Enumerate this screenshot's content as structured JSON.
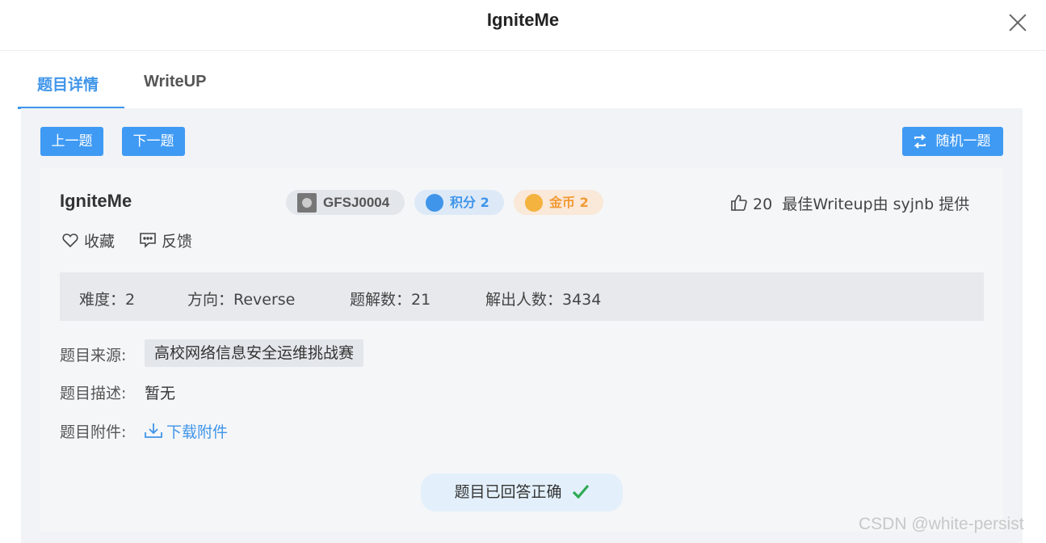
{
  "window": {
    "title": "IgniteMe"
  },
  "tabs": [
    {
      "label": "题目详情",
      "active": true
    },
    {
      "label": "WriteUP",
      "active": false
    }
  ],
  "nav": {
    "prev_label": "上一题",
    "next_label": "下一题",
    "random_label": "随机一题"
  },
  "challenge": {
    "name": "IgniteMe",
    "id": "GFSJ0004",
    "score_label": "积分 2",
    "gold_label": "金币 2",
    "likes": "20",
    "writeup_credit": "最佳Writeup由 syjnb 提供",
    "favorite_label": "收藏",
    "feedback_label": "反馈",
    "stats": {
      "difficulty": "难度：2",
      "direction": "方向：Reverse",
      "solutions": "题解数：21",
      "solvers": "解出人数：3434"
    },
    "source_label": "题目来源:",
    "source_value": "高校网络信息安全运维挑战赛",
    "desc_label": "题目描述:",
    "desc_value": "暂无",
    "attach_label": "题目附件:",
    "attach_link": "下载附件",
    "answered_label": "题目已回答正确"
  },
  "colors": {
    "accent": "#3f95ea",
    "gold": "#f29a36",
    "success": "#2eaa55"
  },
  "watermark": "CSDN @white-persist"
}
